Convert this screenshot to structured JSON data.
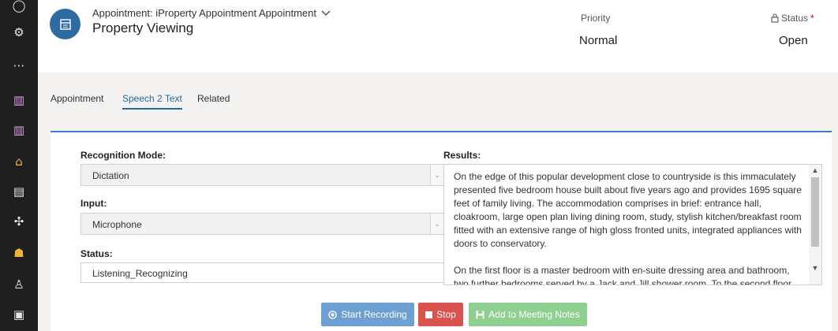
{
  "header": {
    "entity_label": "Appointment: iProperty Appointment Appointment",
    "title": "Property Viewing",
    "priority_label": "Priority",
    "priority_value": "Normal",
    "status_label": "Status",
    "status_required_mark": "*",
    "status_value": "Open"
  },
  "tabs": [
    {
      "label": "Appointment"
    },
    {
      "label": "Speech 2 Text",
      "active": true
    },
    {
      "label": "Related"
    }
  ],
  "form": {
    "recognition_mode_label": "Recognition Mode:",
    "recognition_mode_value": "Dictation",
    "input_label": "Input:",
    "input_value": "Microphone",
    "status_label": "Status:",
    "status_value": "Listening_Recognizing",
    "results_label": "Results:",
    "results_text": "On the edge of this popular development close to countryside is this immaculately presented five bedroom house built about five years ago and provides 1695 square feet of family living. The accommodation comprises in brief: entrance hall, cloakroom, large open plan living dining room, study, stylish kitchen/breakfast room fitted with an extensive range of high gloss fronted units, integrated appliances with doors to conservatory.\n\nOn the first floor is a master bedroom with en-suite dressing area and bathroom, two further bedrooms served by a Jack and Jill shower room. To the second floor"
  },
  "buttons": {
    "start_label": "Start Recording",
    "stop_label": "Stop",
    "add_notes_label": "Add to Meeting Notes"
  },
  "colors": {
    "nav_bg": "#1f1f1f",
    "accent": "#1e6aa6",
    "start_btn": "#6c9fd2",
    "stop_btn": "#d9534f",
    "add_btn": "#8fcf8f"
  },
  "icons": [
    "settings-icon",
    "more-icon",
    "chart-icon",
    "home-icon",
    "clipboard-icon",
    "person-icon",
    "calendar-icon",
    "lock-icon",
    "record-icon",
    "stop-icon",
    "save-icon"
  ]
}
